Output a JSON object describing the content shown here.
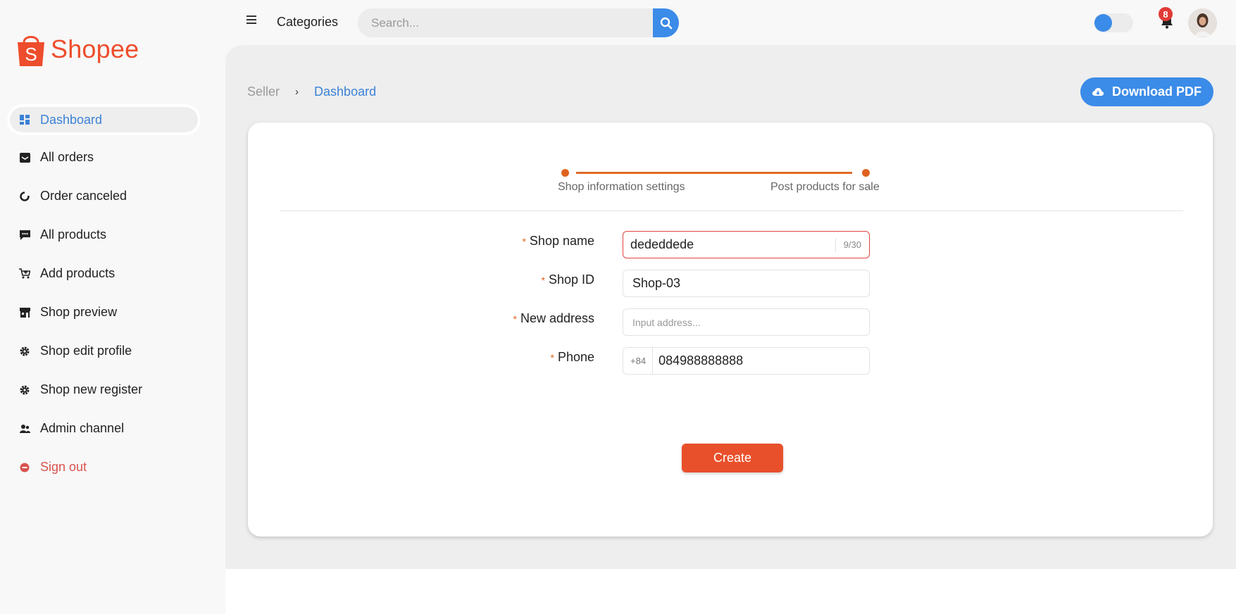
{
  "brand": {
    "name": "Shopee",
    "color": "#ee4d2d"
  },
  "sidebar": {
    "items": [
      {
        "label": "Dashboard",
        "icon": "dashboard-icon",
        "active": true
      },
      {
        "label": "All orders",
        "icon": "inbox-icon"
      },
      {
        "label": "Order canceled",
        "icon": "pie-chart-icon"
      },
      {
        "label": "All products",
        "icon": "chat-box-icon"
      },
      {
        "label": "Add products",
        "icon": "add-cart-icon"
      },
      {
        "label": "Shop preview",
        "icon": "storefront-icon"
      },
      {
        "label": "Shop edit profile",
        "icon": "gear-icon"
      },
      {
        "label": "Shop new register",
        "icon": "gear-icon"
      },
      {
        "label": "Admin channel",
        "icon": "users-icon"
      },
      {
        "label": "Sign out",
        "icon": "minus-circle-icon"
      }
    ]
  },
  "header": {
    "categories_label": "Categories",
    "search_placeholder": "Search...",
    "notification_count": "8",
    "accent_color": "#3b8be8"
  },
  "breadcrumb": {
    "root": "Seller",
    "current": "Dashboard"
  },
  "actions": {
    "download_label": "Download PDF"
  },
  "steps": [
    {
      "label": "Shop information settings"
    },
    {
      "label": "Post products for sale"
    }
  ],
  "form": {
    "shop_name": {
      "label": "Shop name",
      "value": "dededdede",
      "counter": "9/30"
    },
    "shop_id": {
      "label": "Shop ID",
      "value": "Shop-03"
    },
    "address": {
      "label": "New address",
      "placeholder": "Input address..."
    },
    "phone": {
      "label": "Phone",
      "prefix": "+84",
      "value": "084988888888"
    },
    "submit_label": "Create"
  }
}
